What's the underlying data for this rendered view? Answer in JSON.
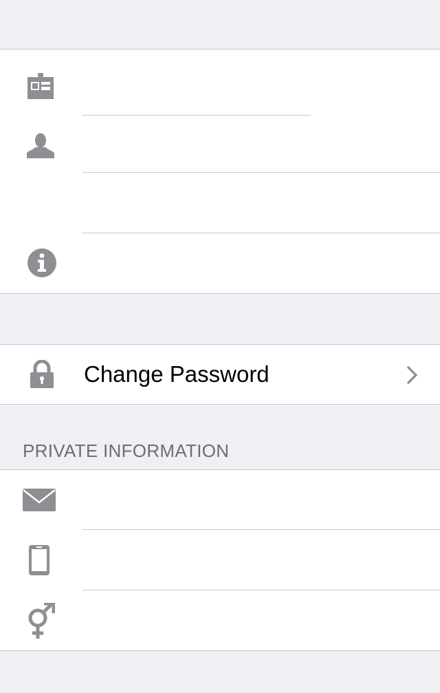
{
  "profile": {
    "fields": [
      {
        "icon": "id-card-icon",
        "value": "",
        "placeholder": ""
      },
      {
        "icon": "person-icon",
        "value": "",
        "placeholder": ""
      },
      {
        "icon": "none",
        "value": "",
        "placeholder": ""
      },
      {
        "icon": "info-icon",
        "value": "",
        "placeholder": ""
      }
    ]
  },
  "security": {
    "change_password_label": "Change Password",
    "lock_icon": "lock-icon",
    "chevron_icon": "chevron-right-icon"
  },
  "private_info": {
    "header": "PRIVATE INFORMATION",
    "fields": [
      {
        "icon": "envelope-icon",
        "value": "",
        "placeholder": ""
      },
      {
        "icon": "phone-icon",
        "value": "",
        "placeholder": ""
      },
      {
        "icon": "gender-icon",
        "value": "",
        "placeholder": ""
      }
    ]
  },
  "colors": {
    "background": "#efeff4",
    "icon_gray": "#8e8e93",
    "separator": "#c8c7cc",
    "section_header": "#6d6d72"
  }
}
